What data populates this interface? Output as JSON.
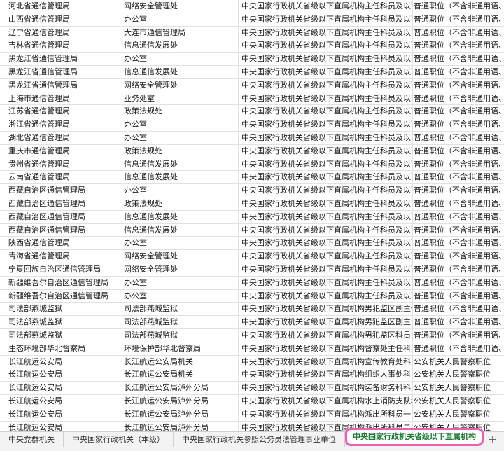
{
  "rows": [
    [
      "河北省通信管理局",
      "网络安全管理处",
      "中央国家行政机关省级以下直属机构主任科员及以下",
      "普通职位（不含非通用语、特"
    ],
    [
      "山西省通信管理局",
      "办公室",
      "中央国家行政机关省级以下直属机构主任科员及以下",
      "普通职位（不含非通用语、特"
    ],
    [
      "辽宁省通信管理局",
      "大连市通信管理局",
      "中央国家行政机关省级以下直属机构主任科员及以下",
      "普通职位（不含非通用语、特"
    ],
    [
      "吉林省通信管理局",
      "信息通信发展处",
      "中央国家行政机关省级以下直属机构主任科员及以下",
      "普通职位（不含非通用语、特"
    ],
    [
      "黑龙江省通信管理局",
      "办公室",
      "中央国家行政机关省级以下直属机构主任科员及以下",
      "普通职位（不含非通用语、特"
    ],
    [
      "黑龙江省通信管理局",
      "信息通信发展处",
      "中央国家行政机关省级以下直属机构主任科员及以下",
      "普通职位（不含非通用语、特"
    ],
    [
      "黑龙江省通信管理局",
      "网络安全管理处",
      "中央国家行政机关省级以下直属机构主任科员及以下",
      "普通职位（不含非通用语、特"
    ],
    [
      "上海市通信管理局",
      "业务处室",
      "中央国家行政机关省级以下直属机构主任科员及以下",
      "普通职位（不含非通用语、特"
    ],
    [
      "江苏省通信管理局",
      "政策法规处",
      "中央国家行政机关省级以下直属机构主任科员及以下",
      "普通职位（不含非通用语、特"
    ],
    [
      "浙江省通信管理局",
      "办公室",
      "中央国家行政机关省级以下直属机构主任科员及以下",
      "普通职位（不含非通用语、特"
    ],
    [
      "湖北省通信管理局",
      "办公室",
      "中央国家行政机关省级以下直属机构主任科员及以下",
      "普通职位（不含非通用语、特"
    ],
    [
      "重庆市通信管理局",
      "政策法规处",
      "中央国家行政机关省级以下直属机构主任科员及以下",
      "普通职位（不含非通用语、特"
    ],
    [
      "贵州省通信管理局",
      "信息通信发展处",
      "中央国家行政机关省级以下直属机构主任科员及以下",
      "普通职位（不含非通用语、特"
    ],
    [
      "云南省通信管理局",
      "信息通信发展处",
      "中央国家行政机关省级以下直属机构主任科员及以下",
      "普通职位（不含非通用语、特"
    ],
    [
      "西藏自治区通信管理局",
      "办公室",
      "中央国家行政机关省级以下直属机构主任科员及以下",
      "普通职位（不含非通用语、特"
    ],
    [
      "西藏自治区通信管理局",
      "政策法规处",
      "中央国家行政机关省级以下直属机构主任科员及以下",
      "普通职位（不含非通用语、特"
    ],
    [
      "西藏自治区通信管理局",
      "信息通信发展处",
      "中央国家行政机关省级以下直属机构主任科员及以下",
      "普通职位（不含非通用语、特"
    ],
    [
      "西藏自治区通信管理局",
      "信息通信发展处",
      "中央国家行政机关省级以下直属机构主任科员及以下",
      "普通职位（不含非通用语、特"
    ],
    [
      "陕西省通信管理局",
      "办公室",
      "中央国家行政机关省级以下直属机构主任科员及以下",
      "普通职位（不含非通用语、特"
    ],
    [
      "青海省通信管理局",
      "网络安全管理处",
      "中央国家行政机关省级以下直属机构主任科员及以下",
      "普通职位（不含非通用语、特"
    ],
    [
      "宁夏回族自治区通信管理局",
      "网络安全管理处",
      "中央国家行政机关省级以下直属机构主任科员及以下",
      "普通职位（不含非通用语、特"
    ],
    [
      "新疆维吾尔自治区通信管理局",
      "办公室",
      "中央国家行政机关省级以下直属机构主任科员及以下",
      "普通职位（不含非通用语、特"
    ],
    [
      "新疆维吾尔自治区通信管理局",
      "办公室",
      "中央国家行政机关省级以下直属机构主任科员及以下",
      "普通职位（不含非通用语、特"
    ],
    [
      "司法部燕城监狱",
      "司法部燕城监狱",
      "中央国家行政机关省级以下直属机构男犯监区副主任科员",
      "普通职位（不含非通用语、特"
    ],
    [
      "司法部燕城监狱",
      "司法部燕城监狱",
      "中央国家行政机关省级以下直属机构男犯监区副主任科员",
      "普通职位（不含非通用语、特"
    ],
    [
      "司法部燕城监狱",
      "司法部燕城监狱",
      "中央国家行政机关省级以下直属机构男犯监区科员",
      "普通职位（不含非通用语、特"
    ],
    [
      "生态环境部华北督察局",
      "环境保护部华北督察局",
      "中央国家行政机关省级以下直属机构督察处主任科员及",
      "普通职位（不含非通用语、特"
    ],
    [
      "长江航运公安局",
      "长江航运公安局机关",
      "中央国家行政机关省级以下直属机构宣传教育处科员",
      "公安机关人民警察职位"
    ],
    [
      "长江航运公安局",
      "长江航运公安局机关",
      "中央国家行政机关省级以下直属机构组织人事处科员",
      "公安机关人民警察职位"
    ],
    [
      "长江航运公安局",
      "长江航运公安局泸州分局",
      "中央国家行政机关省级以下直属机构装备财务科科员",
      "公安机关人民警察职位"
    ],
    [
      "长江航运公安局",
      "长江航运公安局泸州分局",
      "中央国家行政机关省级以下直属机构水上消防支队科员",
      "公安机关人民警察职位"
    ],
    [
      "长江航运公安局",
      "长江航运公安局泸州分局",
      "中央国家行政机关省级以下直属机构派出所科员一",
      "公安机关人民警察职位"
    ],
    [
      "长江航运公安局",
      "长江航运公安局泸州分局",
      "中央国家行政机关省级以下直属机构派出所科员二",
      "公安机关人民警察职位"
    ]
  ],
  "tabs": [
    {
      "label": "中央党群机关",
      "active": false
    },
    {
      "label": "中央国家行政机关（本级）",
      "active": false
    },
    {
      "label": "中央国家行政机关参照公务员法管理事业单位",
      "active": false
    },
    {
      "label": "中央国家行政机关省级以下直属机构",
      "active": true
    }
  ],
  "add_tab_label": "+",
  "colors": {
    "active_tab_text": "#1e7b34",
    "active_tab_highlight": "#ee5fb2"
  }
}
